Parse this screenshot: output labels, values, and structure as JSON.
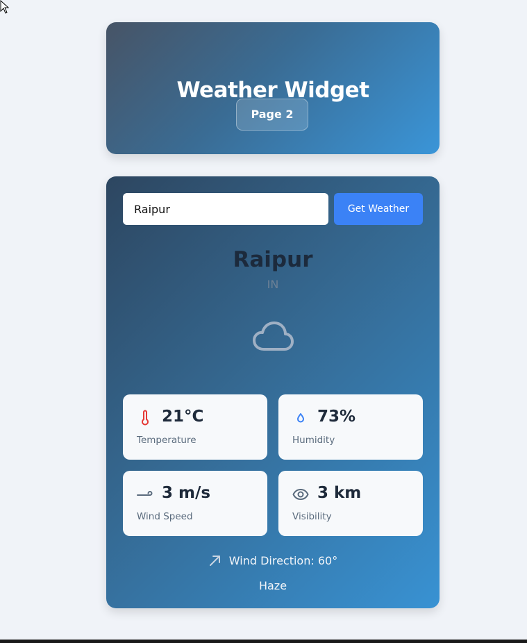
{
  "header": {
    "title": "Weather Widget",
    "page_button_label": "Page 2"
  },
  "search": {
    "value": "Raipur",
    "button_label": "Get Weather"
  },
  "location": {
    "city": "Raipur",
    "country": "IN"
  },
  "current_icon": "cloud-icon",
  "stats": {
    "temperature": {
      "value": "21°C",
      "label": "Temperature",
      "icon": "thermometer-icon"
    },
    "humidity": {
      "value": "73%",
      "label": "Humidity",
      "icon": "droplet-icon"
    },
    "wind_speed": {
      "value": "3 m/s",
      "label": "Wind Speed",
      "icon": "wind-icon"
    },
    "visibility": {
      "value": "3 km",
      "label": "Visibility",
      "icon": "eye-icon"
    }
  },
  "wind_direction": {
    "text": "Wind Direction: 60°",
    "icon": "arrow-up-right-icon"
  },
  "condition": "Haze",
  "colors": {
    "accent": "#3b82f6",
    "thermometer": "#e53935",
    "droplet": "#3b82f6",
    "stat_text": "#1e2a3a"
  }
}
